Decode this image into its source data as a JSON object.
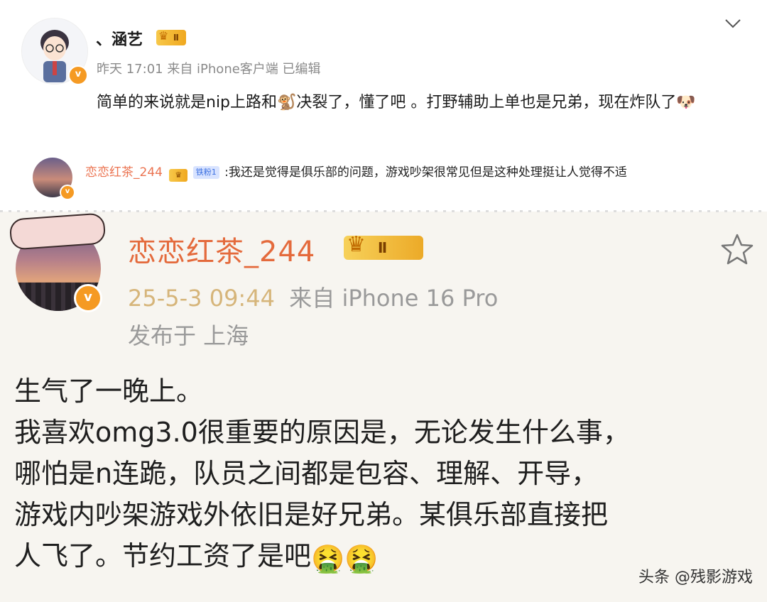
{
  "post": {
    "username": "、涵艺",
    "level_badge": "Ⅱ",
    "meta": "昨天 17:01  来自 iPhone客户端  已编辑",
    "text": "简单的来说就是nip上路和🐒决裂了，懂了吧 。打野辅助上单也是兄弟，现在炸队了🐶",
    "verified_mark": "v"
  },
  "comment": {
    "username": "恋恋红茶_244",
    "fan_badge": "铁粉1",
    "text": ":我还是觉得是俱乐部的问题，游戏吵架很常见但是这种处理挺让人觉得不适"
  },
  "screenshot": {
    "username": "恋恋红茶_244",
    "level_badge": "Ⅱ",
    "time": "25-5-3 09:44",
    "source": "来自 iPhone 16 Pro",
    "location": "发布于 上海",
    "lines": [
      "生气了一晚上。",
      "我喜欢omg3.0很重要的原因是，无论发生什么事，",
      "哪怕是n连跪，队员之间都是包容、理解、开导，",
      "游戏内吵架游戏外依旧是好兄弟。某俱乐部直接把",
      "人飞了。节约工资了是吧"
    ],
    "emojis": "🤮🤮"
  },
  "watermark": "头条 @残影游戏",
  "icons": [
    "chevron-down-icon",
    "star-icon",
    "crown-icon",
    "verified-icon"
  ]
}
